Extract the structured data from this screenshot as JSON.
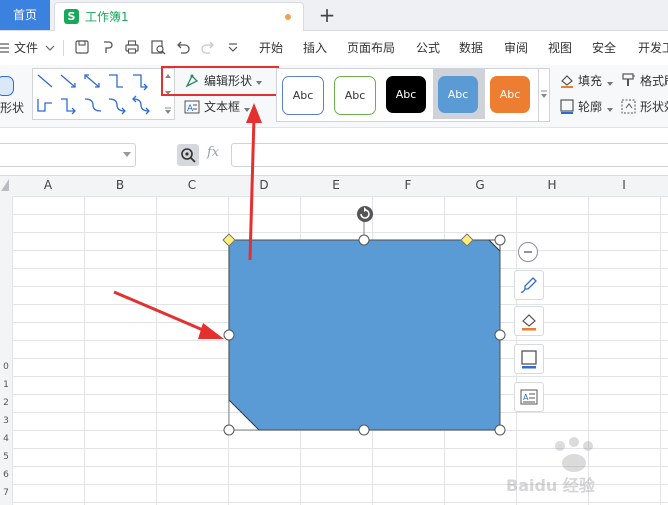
{
  "tabs": {
    "home": "首页",
    "workbook": "工作簿1",
    "new_tab": "+"
  },
  "menu": {
    "file": "文件",
    "items": [
      "开始",
      "插入",
      "页面布局",
      "公式",
      "数据",
      "审阅",
      "视图",
      "安全",
      "开发工"
    ]
  },
  "ribbon": {
    "shape_label": "形状",
    "edit_shape": "编辑形状",
    "text_box": "文本框",
    "swatch_text": "Abc",
    "fill": "填充",
    "outline": "轮廓",
    "format_brush": "格式刷",
    "shape_effect": "形状效"
  },
  "formula": {
    "fx": "fx"
  },
  "columns": [
    "A",
    "B",
    "C",
    "D",
    "E",
    "F",
    "G",
    "H",
    "I"
  ],
  "rows": [
    "0",
    "1",
    "2",
    "3",
    "4",
    "5",
    "6",
    "7"
  ],
  "watermark": "Baidu 经验",
  "colors": {
    "accent_blue": "#3b82e0",
    "shape_fill": "#5b9bd5",
    "swatch_orange": "#ed7d31",
    "swatch_black": "#000000",
    "highlight_red": "#e53030",
    "handle_yellow": "#ffef7a"
  }
}
